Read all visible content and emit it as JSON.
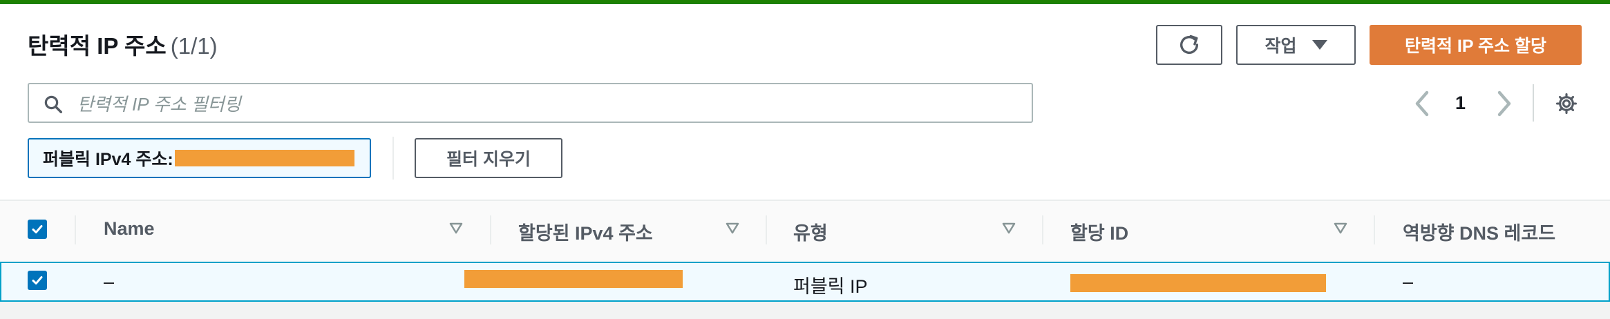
{
  "header": {
    "title": "탄력적 IP 주소",
    "count": "(1/1)"
  },
  "toolbar": {
    "refresh_icon": "refresh-icon",
    "actions_label": "작업",
    "allocate_label": "탄력적 IP 주소 할당"
  },
  "search": {
    "placeholder": "탄력적 IP 주소 필터링",
    "value": ""
  },
  "pagination": {
    "current_page": "1"
  },
  "filter": {
    "token_label": "퍼블릭 IPv4 주소:",
    "clear_label": "필터 지우기"
  },
  "table": {
    "columns": [
      "Name",
      "할당된 IPv4 주소",
      "유형",
      "할당 ID",
      "역방향 DNS 레코드"
    ],
    "rows": [
      {
        "name": "–",
        "ipv4": "",
        "type": "퍼블릭 IP",
        "allocation_id": "",
        "reverse_dns": "–",
        "selected": true
      }
    ]
  },
  "colors": {
    "accent_green": "#1d8102",
    "primary_orange": "#e07b39",
    "checkbox_blue": "#0073bb",
    "redaction": "#f29d38"
  }
}
